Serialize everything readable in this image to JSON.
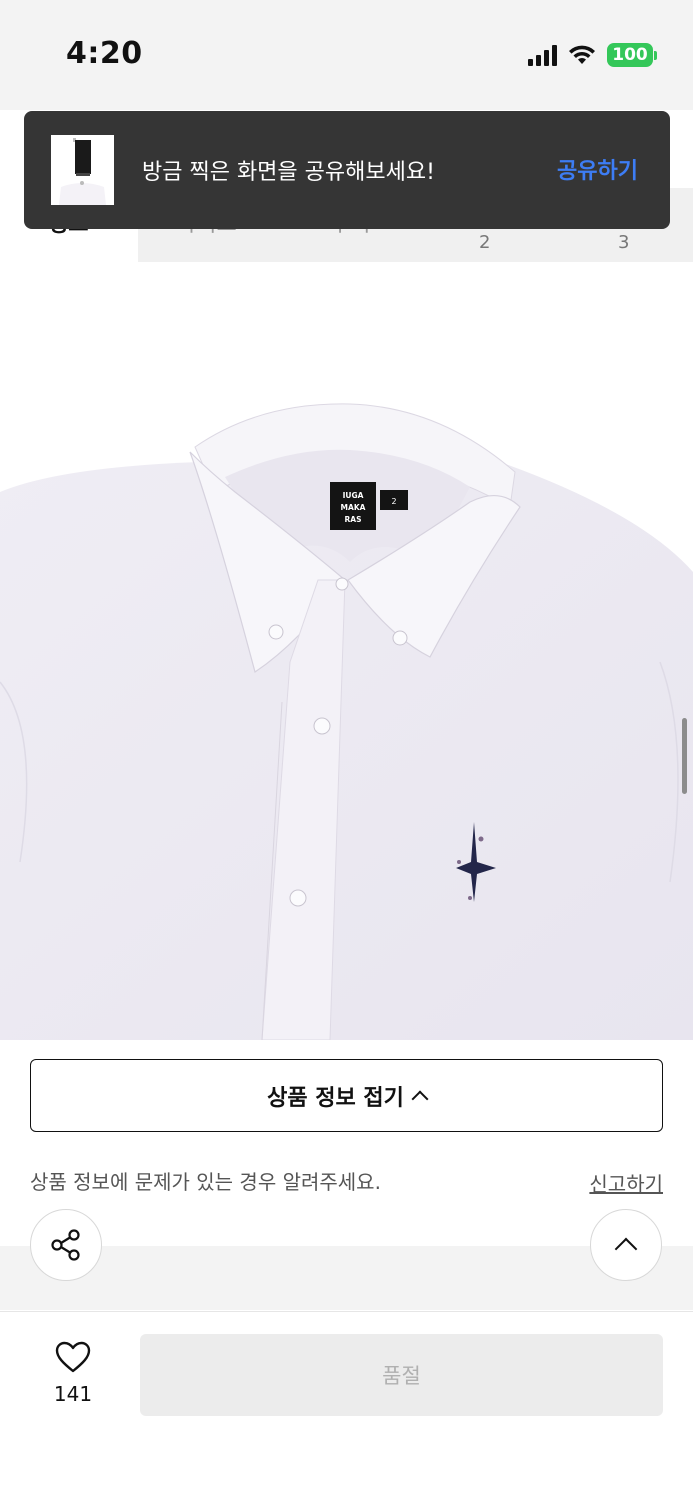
{
  "status_bar": {
    "time": "4:20",
    "battery": "100",
    "icons": [
      "cellular-signal-icon",
      "wifi-icon",
      "battery-icon"
    ],
    "battery_color": "#34c759"
  },
  "tabs": {
    "partial_tab_1": "정보",
    "partial_tab_2": "사이즈",
    "partial_tab_3": "후기",
    "count_a": "2",
    "count_b": "3"
  },
  "toast": {
    "message": "방금 찍은 화면을 공유해보세요!",
    "action_label": "공유하기",
    "action_color": "#3d7df5",
    "background": "#353535"
  },
  "product_image": {
    "description_icon": "shirt-image",
    "label_lines": [
      "IUGA",
      "MAKA",
      "RAS"
    ],
    "size_tag": "2"
  },
  "product_info": {
    "collapse_label": "상품 정보 접기",
    "report_prompt": "상품 정보에 문제가 있는 경우 알려주세요.",
    "report_link": "신고하기"
  },
  "bottom_bar": {
    "like_count": "141",
    "soldout_label": "품절"
  }
}
